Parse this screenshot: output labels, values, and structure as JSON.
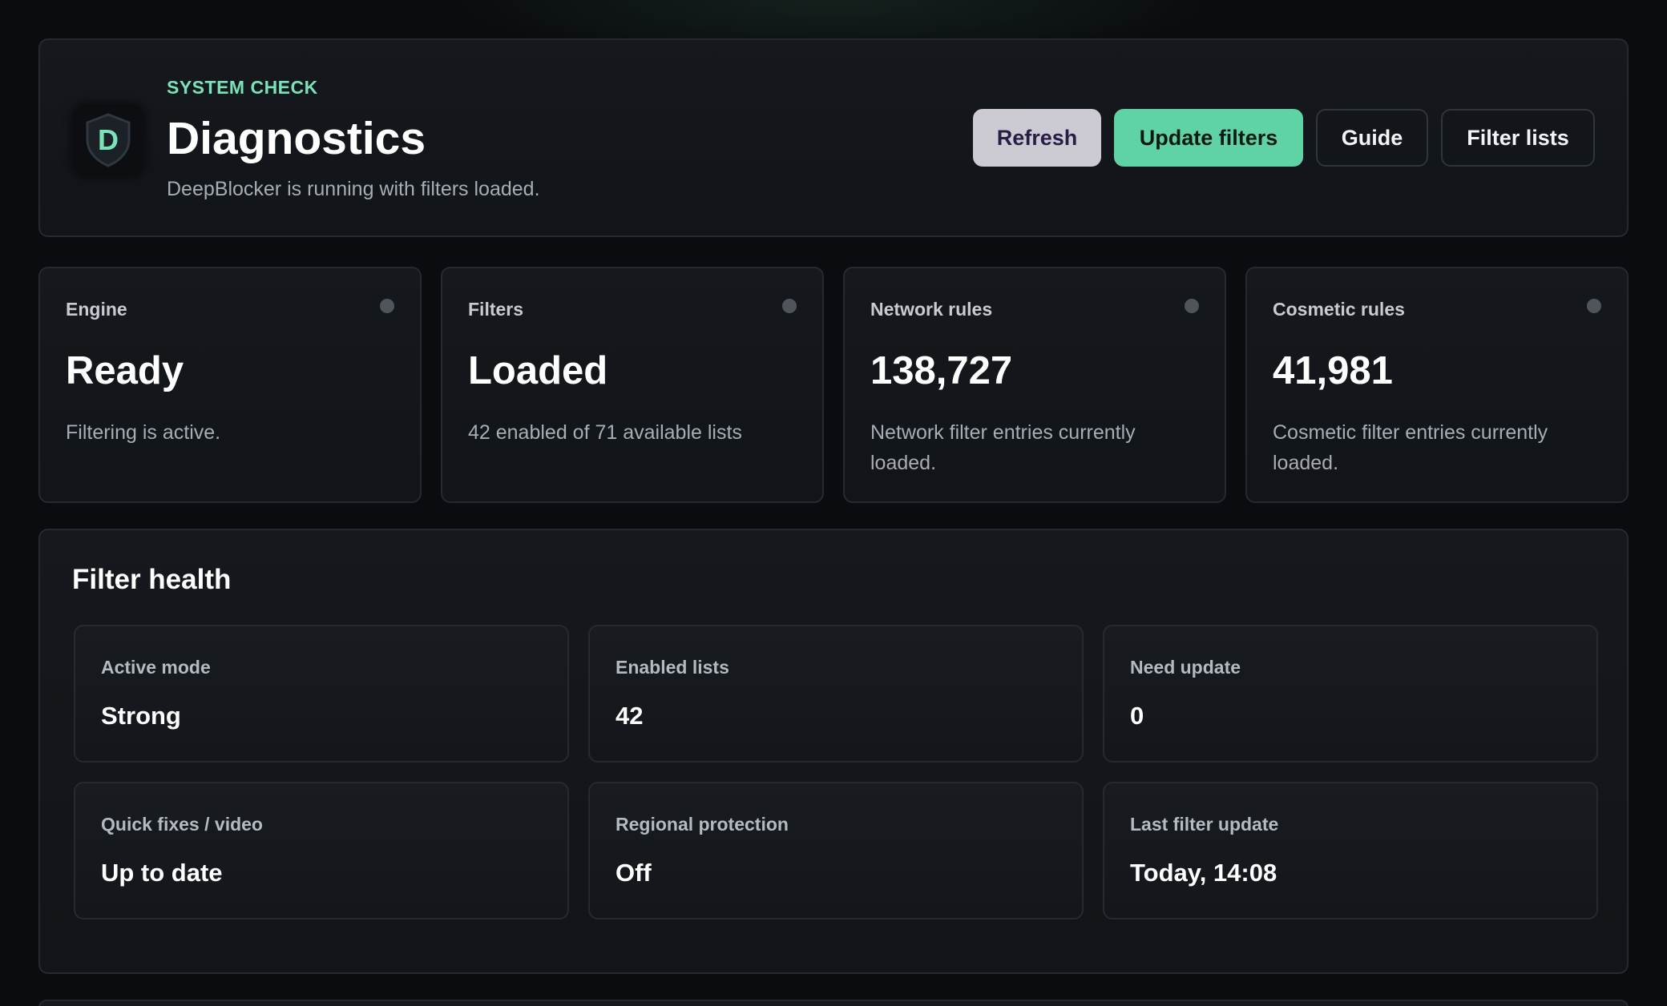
{
  "header": {
    "eyebrow": "SYSTEM CHECK",
    "title": "Diagnostics",
    "subtitle": "DeepBlocker is running with filters loaded.",
    "logo_letter": "D",
    "logo_icon": "shield-icon",
    "buttons": {
      "refresh": "Refresh",
      "update_filters": "Update filters",
      "guide": "Guide",
      "filter_lists": "Filter lists"
    }
  },
  "stats": [
    {
      "label": "Engine",
      "value": "Ready",
      "description": "Filtering is active."
    },
    {
      "label": "Filters",
      "value": "Loaded",
      "description": "42 enabled of 71 available lists"
    },
    {
      "label": "Network rules",
      "value": "138,727",
      "description": "Network filter entries currently loaded."
    },
    {
      "label": "Cosmetic rules",
      "value": "41,981",
      "description": "Cosmetic filter entries currently loaded."
    }
  ],
  "health": {
    "title": "Filter health",
    "metrics": [
      {
        "label": "Active mode",
        "value": "Strong"
      },
      {
        "label": "Enabled lists",
        "value": "42"
      },
      {
        "label": "Need update",
        "value": "0"
      },
      {
        "label": "Quick fixes / video",
        "value": "Up to date"
      },
      {
        "label": "Regional protection",
        "value": "Off"
      },
      {
        "label": "Last filter update",
        "value": "Today, 14:08"
      }
    ]
  },
  "colors": {
    "accent": "#60d3a6",
    "eyebrow": "#79e2b8",
    "background": "#0a0c0f",
    "card": "#15181c",
    "status_dot": "#50555c"
  }
}
